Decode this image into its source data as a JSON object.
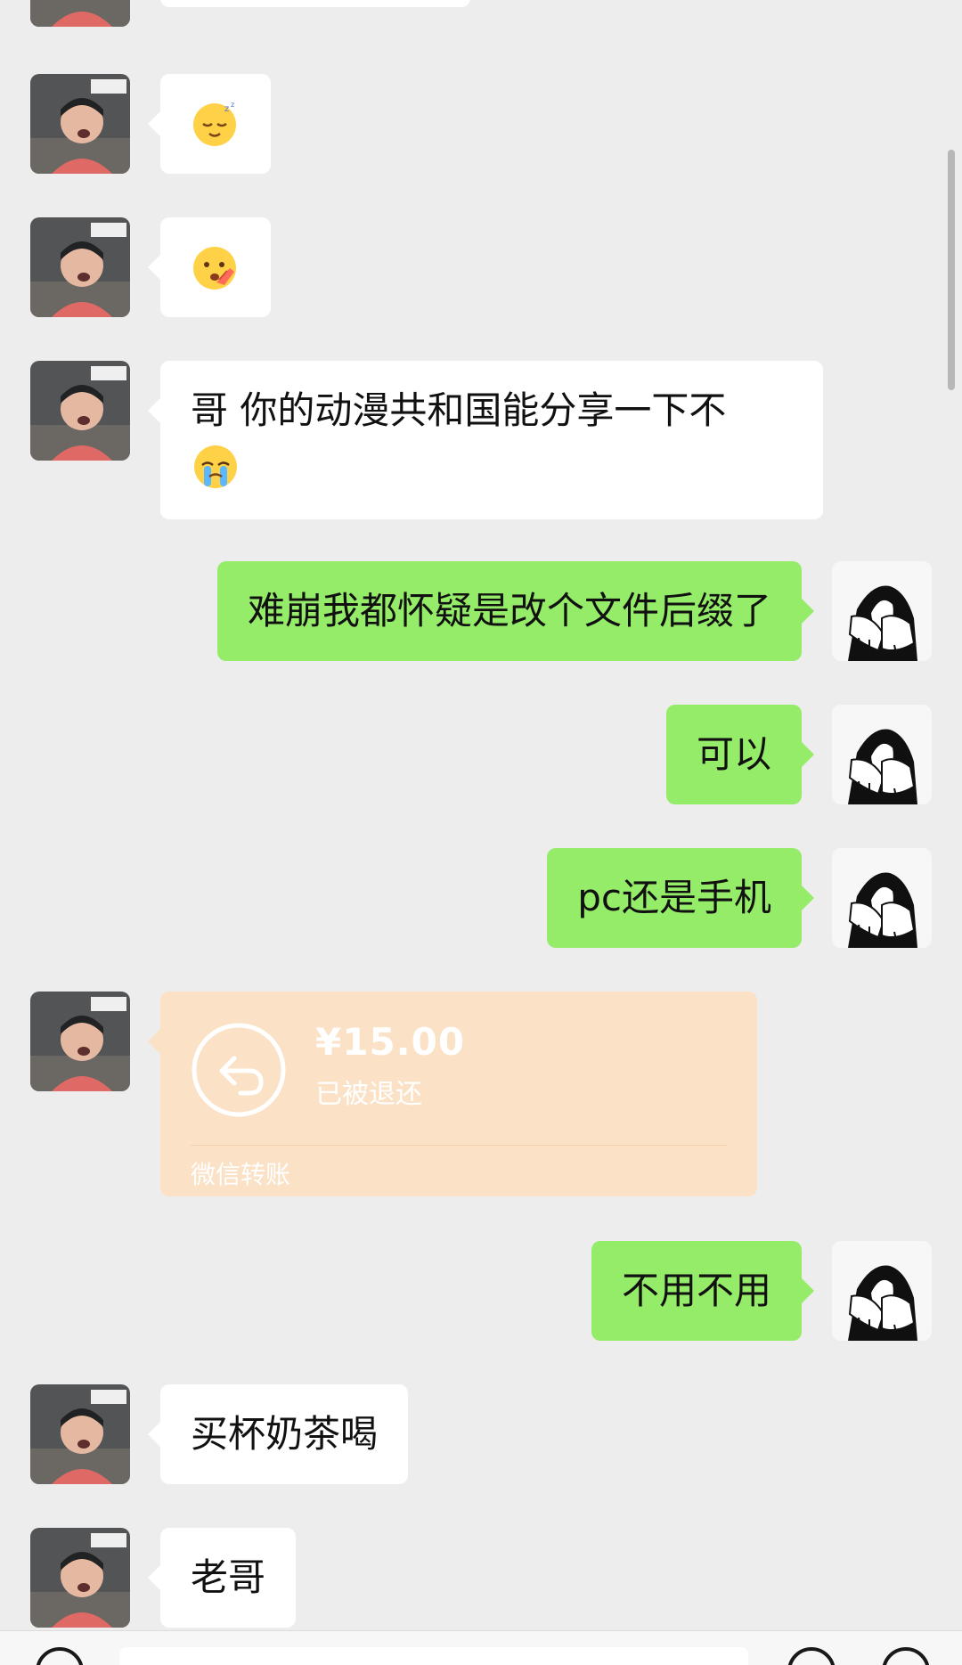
{
  "colors": {
    "background": "#ededed",
    "incoming_bubble": "#ffffff",
    "outgoing_bubble": "#95ec69",
    "transfer_card": "#fbe1c6"
  },
  "messages": [
    {
      "side": "incoming",
      "kind": "emoji",
      "emoji": "sleeping-face-icon"
    },
    {
      "side": "incoming",
      "kind": "emoji",
      "emoji": "face-with-hand-over-mouth-icon"
    },
    {
      "side": "incoming",
      "kind": "text",
      "text": "哥 你的动漫共和国能分享一下不",
      "emoji": "loudly-crying-face-icon"
    },
    {
      "side": "outgoing",
      "kind": "text",
      "text": "难崩我都怀疑是改个文件后缀了"
    },
    {
      "side": "outgoing",
      "kind": "text",
      "text": "可以"
    },
    {
      "side": "outgoing",
      "kind": "text",
      "text": "pc还是手机"
    },
    {
      "side": "incoming",
      "kind": "transfer",
      "amount": "¥15.00",
      "status": "已被退还",
      "label": "微信转账"
    },
    {
      "side": "outgoing",
      "kind": "text",
      "text": "不用不用"
    },
    {
      "side": "incoming",
      "kind": "text",
      "text": "买杯奶茶喝"
    },
    {
      "side": "incoming",
      "kind": "text",
      "text": "老哥"
    }
  ],
  "input_bar": {
    "voice_icon": "voice-icon",
    "emoji_icon": "smile-icon",
    "plus_icon": "plus-icon"
  }
}
